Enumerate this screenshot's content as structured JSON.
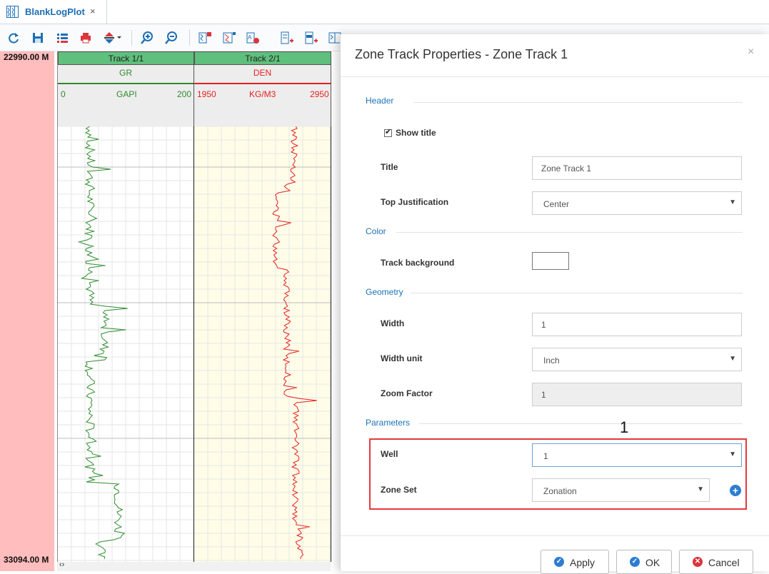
{
  "tab": {
    "title": "BlankLogPlot",
    "close": "×"
  },
  "toolbar": {
    "icons": [
      "refresh-icon",
      "save-icon",
      "list-icon",
      "print-icon",
      "fill-dropdown-icon",
      "zoom-in-icon",
      "zoom-out-icon",
      "add-track-icon",
      "add-curve-track-icon",
      "add-text-track-icon",
      "add-depth-track-icon",
      "add-zone-track-icon",
      "add-image-track-icon"
    ]
  },
  "depth": {
    "top": "22990.00 M",
    "bottom": "33094.00 M"
  },
  "tracks": [
    {
      "title": "Track 1/1",
      "curve": "GR",
      "unit": "GAPI",
      "min": "0",
      "max": "200",
      "color": "#2e8b2e",
      "background": "#ffffff"
    },
    {
      "title": "Track 2/1",
      "curve": "DEN",
      "unit": "KG/M3",
      "min": "1950",
      "max": "2950",
      "color": "#e62020",
      "background": "#fffde8"
    }
  ],
  "dialog": {
    "title": "Zone Track Properties - Zone Track 1",
    "close": "×",
    "sections": {
      "header": "Header",
      "color": "Color",
      "geometry": "Geometry",
      "parameters": "Parameters"
    },
    "show_title": {
      "label": "Show title",
      "checked": true
    },
    "title_field": {
      "label": "Title",
      "value": "Zone Track 1"
    },
    "top_justification": {
      "label": "Top Justification",
      "value": "Center"
    },
    "track_background": {
      "label": "Track background",
      "value": "#ffffff"
    },
    "width": {
      "label": "Width",
      "value": "1"
    },
    "width_unit": {
      "label": "Width unit",
      "value": "Inch"
    },
    "zoom_factor": {
      "label": "Zoom Factor",
      "value": "1"
    },
    "well": {
      "label": "Well",
      "value": "1"
    },
    "zone_set": {
      "label": "Zone Set",
      "value": "Zonation"
    },
    "annotation_marker": "1",
    "buttons": {
      "apply": "Apply",
      "ok": "OK",
      "cancel": "Cancel"
    }
  },
  "colors": {
    "accent": "#1e73b8",
    "highlight": "#e2393d",
    "depth_column": "#ffbdbd",
    "track_header": "#5fbf7c"
  }
}
